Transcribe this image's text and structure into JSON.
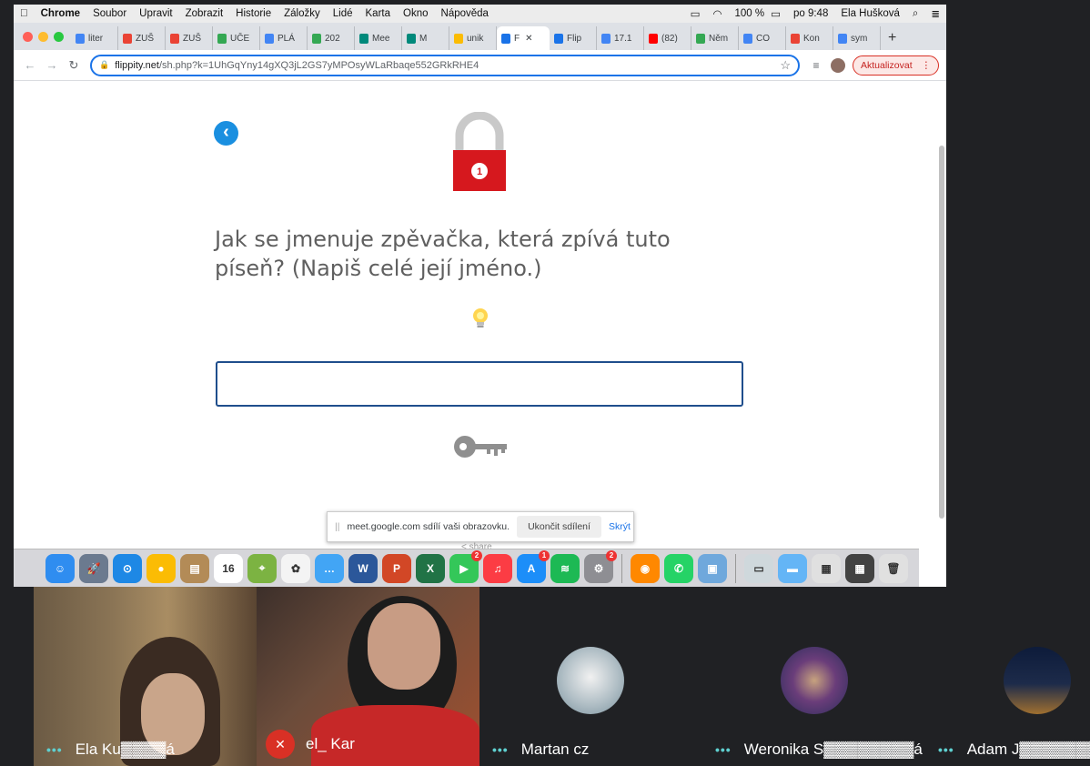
{
  "menubar": {
    "app_name": "Chrome",
    "menus": [
      "Soubor",
      "Upravit",
      "Zobrazit",
      "Historie",
      "Záložky",
      "Lidé",
      "Karta",
      "Okno",
      "Nápověda"
    ],
    "battery": "100 %",
    "clock": "po 9:48",
    "user": "Ela Hušková"
  },
  "tabs": [
    {
      "label": "liter",
      "favicon_color": "#4285f4"
    },
    {
      "label": "ZUŠ",
      "favicon_color": "#ea4335"
    },
    {
      "label": "ZUŠ",
      "favicon_color": "#ea4335"
    },
    {
      "label": "UČE",
      "favicon_color": "#34a853"
    },
    {
      "label": "PLÁ",
      "favicon_color": "#4285f4"
    },
    {
      "label": "202",
      "favicon_color": "#34a853"
    },
    {
      "label": "Mee",
      "favicon_color": "#00897b"
    },
    {
      "label": "M",
      "favicon_color": "#00897b"
    },
    {
      "label": "unik",
      "favicon_color": "#fbbc04"
    },
    {
      "label": "F",
      "favicon_color": "#1a73e8"
    },
    {
      "label": "Flip",
      "favicon_color": "#1a73e8"
    },
    {
      "label": "17.1",
      "favicon_color": "#4285f4"
    },
    {
      "label": "(82)",
      "favicon_color": "#ff0000"
    },
    {
      "label": "Něm",
      "favicon_color": "#34a853"
    },
    {
      "label": "CO",
      "favicon_color": "#4285f4"
    },
    {
      "label": "Kon",
      "favicon_color": "#ea4335"
    },
    {
      "label": "sym",
      "favicon_color": "#4285f4"
    }
  ],
  "address": {
    "domain": "flippity.net",
    "path": "/sh.php?k=1UhGqYny14gXQ3jL2GS7yMPOsyWLaRbaqe552GRkRHE4",
    "update_label": "Aktualizovat"
  },
  "page": {
    "lock_number": "1",
    "question": "Jak se jmenuje zpěvačka, která zpívá tuto píseň? (Napiš celé její jméno.)",
    "answer_value": "",
    "share_text": "share"
  },
  "sharebar": {
    "message": "meet.google.com sdílí vaši obrazovku.",
    "stop_label": "Ukončit sdílení",
    "hide_label": "Skrýt"
  },
  "dock": {
    "apps": [
      {
        "name": "finder",
        "color": "#2f8df0",
        "glyph": "☺"
      },
      {
        "name": "launchpad",
        "color": "#6b7a8f",
        "glyph": "🚀"
      },
      {
        "name": "safari",
        "color": "#1e88e5",
        "glyph": "⊙"
      },
      {
        "name": "chrome",
        "color": "#fbbc04",
        "glyph": "●"
      },
      {
        "name": "notes",
        "color": "#b38b57",
        "glyph": "▤"
      },
      {
        "name": "calendar",
        "color": "#ffffff",
        "glyph": "16"
      },
      {
        "name": "maps",
        "color": "#7cb342",
        "glyph": "⌖"
      },
      {
        "name": "photos",
        "color": "#f4f4f4",
        "glyph": "✿"
      },
      {
        "name": "messages",
        "color": "#42a5f5",
        "glyph": "…"
      },
      {
        "name": "word",
        "color": "#2b579a",
        "glyph": "W"
      },
      {
        "name": "powerpoint",
        "color": "#d24726",
        "glyph": "P"
      },
      {
        "name": "excel",
        "color": "#217346",
        "glyph": "X"
      },
      {
        "name": "facetime",
        "color": "#34c759",
        "glyph": "▶",
        "badge": "2"
      },
      {
        "name": "music",
        "color": "#fc3c44",
        "glyph": "♫"
      },
      {
        "name": "appstore",
        "color": "#1c8ef9",
        "glyph": "A",
        "badge": "1"
      },
      {
        "name": "spotify",
        "color": "#1db954",
        "glyph": "≋"
      },
      {
        "name": "settings",
        "color": "#8e8e93",
        "glyph": "⚙",
        "badge": "2"
      }
    ],
    "apps_right": [
      {
        "name": "vlc",
        "color": "#ff8800",
        "glyph": "◉"
      },
      {
        "name": "whatsapp",
        "color": "#25d366",
        "glyph": "✆"
      },
      {
        "name": "preview",
        "color": "#6fa8dc",
        "glyph": "▣"
      }
    ],
    "apps_folders": [
      {
        "name": "disk",
        "color": "#cfd8dc",
        "glyph": "▭"
      },
      {
        "name": "folder",
        "color": "#64b5f6",
        "glyph": "▬"
      },
      {
        "name": "screenshot-1",
        "color": "#e0e0e0",
        "glyph": "▦"
      },
      {
        "name": "screenshot-2",
        "color": "#424242",
        "glyph": "▦"
      },
      {
        "name": "trash",
        "color": "#e0e0e0",
        "glyph": "🗑"
      }
    ]
  },
  "meet": {
    "participants": [
      {
        "name": "Ela Ku▓▓▓▓á"
      },
      {
        "name": "el_ Kar"
      },
      {
        "name": "Martan cz"
      },
      {
        "name": "Weronika S▓▓▓▓▓▓▓▓á"
      },
      {
        "name": "Adam J▓▓▓▓▓▓▓▓▓"
      }
    ]
  }
}
